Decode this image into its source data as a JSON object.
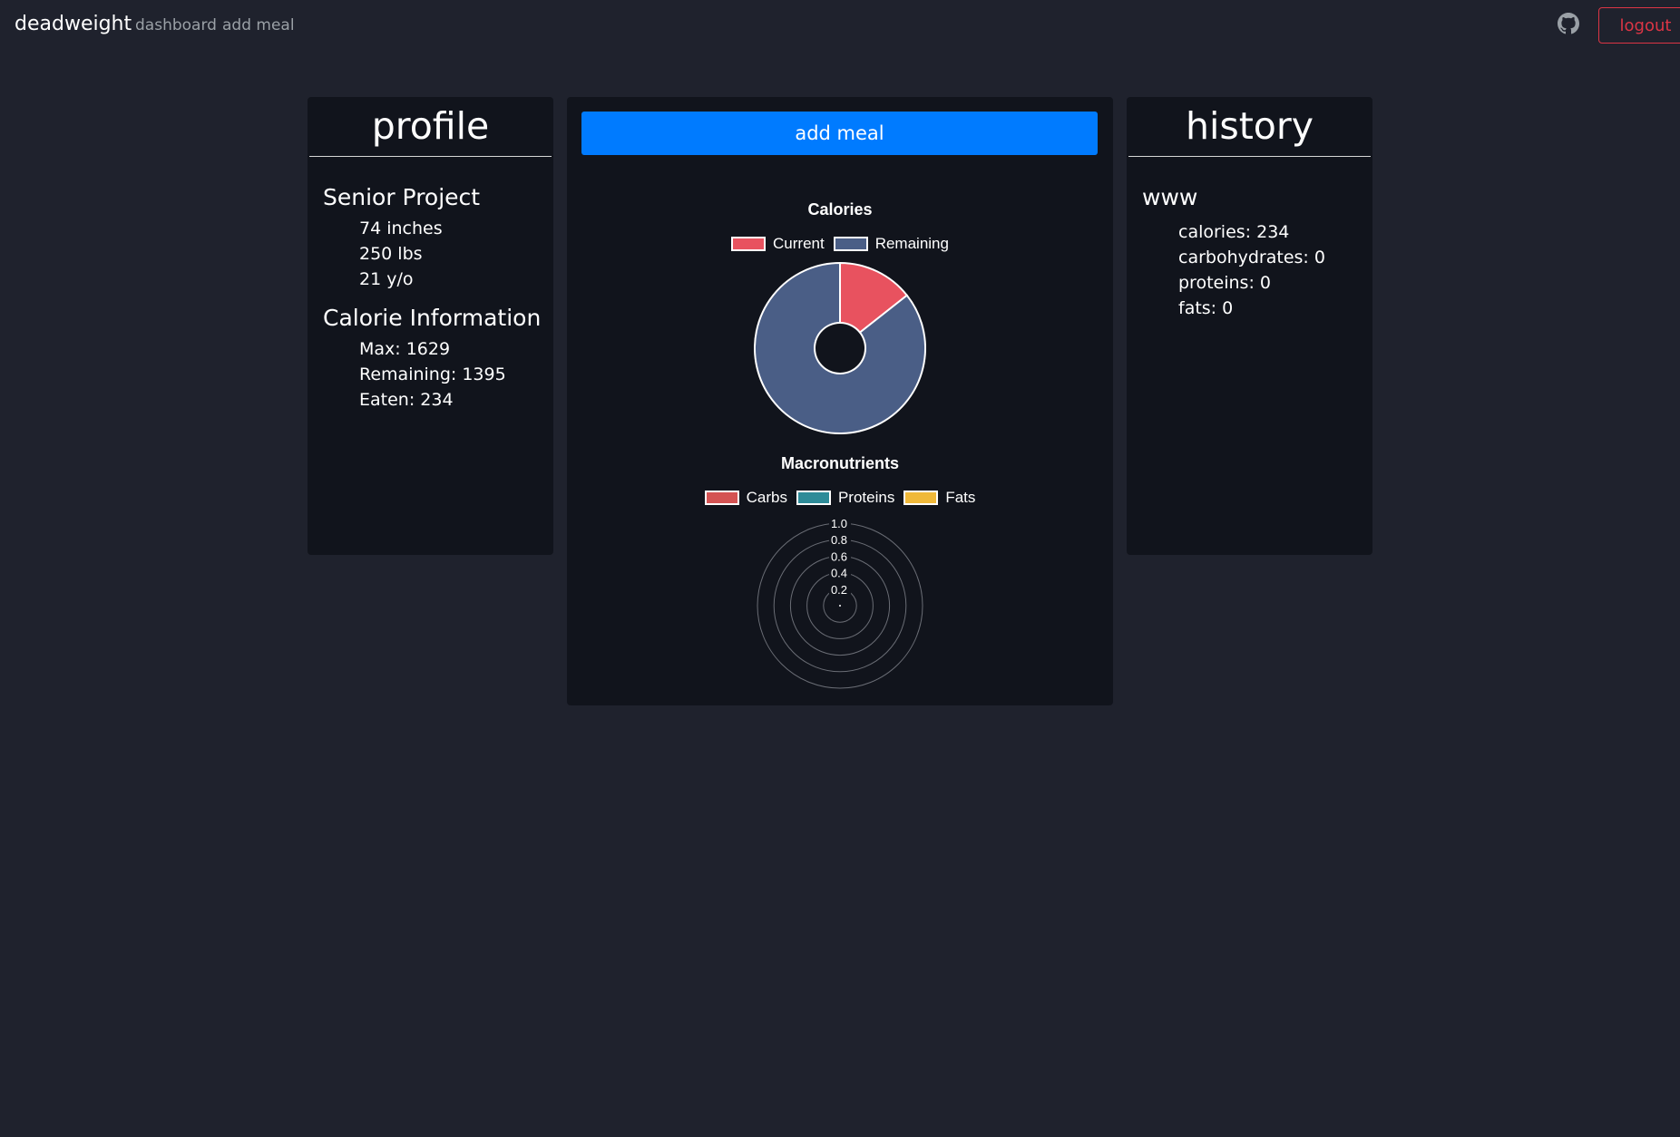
{
  "nav": {
    "brand": "deadweight",
    "links": [
      "dashboard",
      "add meal"
    ],
    "logout_label": "logout"
  },
  "profile": {
    "title": "profile",
    "name": "Senior Project",
    "height": "74 inches",
    "weight": "250 lbs",
    "age": "21 y/o",
    "calorie_heading": "Calorie Information",
    "max": "Max: 1629",
    "remaining": "Remaining: 1395",
    "eaten": "Eaten: 234"
  },
  "center": {
    "add_meal_label": "add meal"
  },
  "history": {
    "title": "history",
    "meal_name": "www",
    "calories": "calories: 234",
    "carbohydrates": "carbohydrates: 0",
    "proteins": "proteins: 0",
    "fats": "fats: 0"
  },
  "chart_data": [
    {
      "type": "doughnut",
      "title": "Calories",
      "categories": [
        "Current",
        "Remaining"
      ],
      "values": [
        234,
        1395
      ],
      "colors": [
        "#e8525f",
        "#4a5e86"
      ],
      "legend": "top"
    },
    {
      "type": "polarArea",
      "title": "Macronutrients",
      "categories": [
        "Carbs",
        "Proteins",
        "Fats"
      ],
      "values": [
        0,
        0,
        0
      ],
      "colors": [
        "#d45353",
        "#2e8b98",
        "#f0b93a"
      ],
      "r_ticks": [
        "0.2",
        "0.4",
        "0.6",
        "0.8",
        "1.0"
      ],
      "rlim": [
        0,
        1.0
      ],
      "legend": "top"
    }
  ]
}
